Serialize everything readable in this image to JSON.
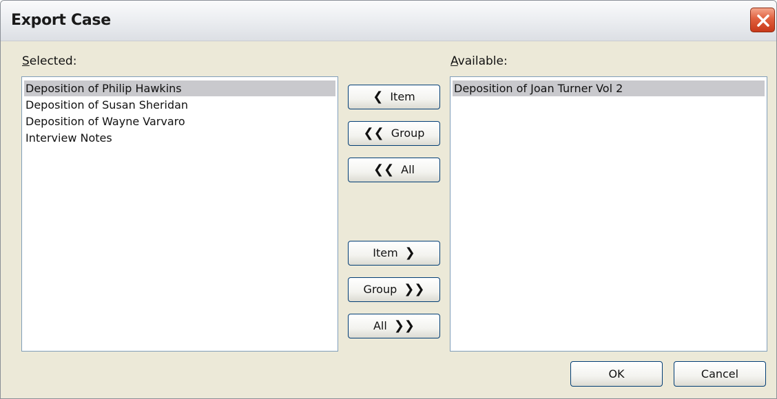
{
  "window": {
    "title": "Export Case"
  },
  "selected": {
    "label_accel": "S",
    "label_rest": "elected:",
    "items": [
      "Deposition of Philip Hawkins",
      "Deposition of Susan Sheridan",
      "Deposition of Wayne Varvaro",
      "Interview Notes"
    ],
    "highlighted_index": 0
  },
  "available": {
    "label_accel": "A",
    "label_rest": "vailable:",
    "items": [
      "Deposition of Joan Turner Vol 2"
    ],
    "highlighted_index": 0
  },
  "move_buttons": {
    "item_left": {
      "label": "Item",
      "glyph": "❮"
    },
    "group_left": {
      "label": "Group",
      "glyph": "❮❮"
    },
    "all_left": {
      "label": "All",
      "glyph": "❮❮"
    },
    "item_right": {
      "label": "Item",
      "glyph": "❯"
    },
    "group_right": {
      "label": "Group",
      "glyph": "❯❯"
    },
    "all_right": {
      "label": "All",
      "glyph": "❯❯"
    }
  },
  "footer": {
    "ok_label": "OK",
    "cancel_label": "Cancel"
  },
  "colors": {
    "dialog_bg": "#ece9d8",
    "list_border": "#7f9db9",
    "selection": "#c9c9cd",
    "close_red": "#d9532f"
  }
}
